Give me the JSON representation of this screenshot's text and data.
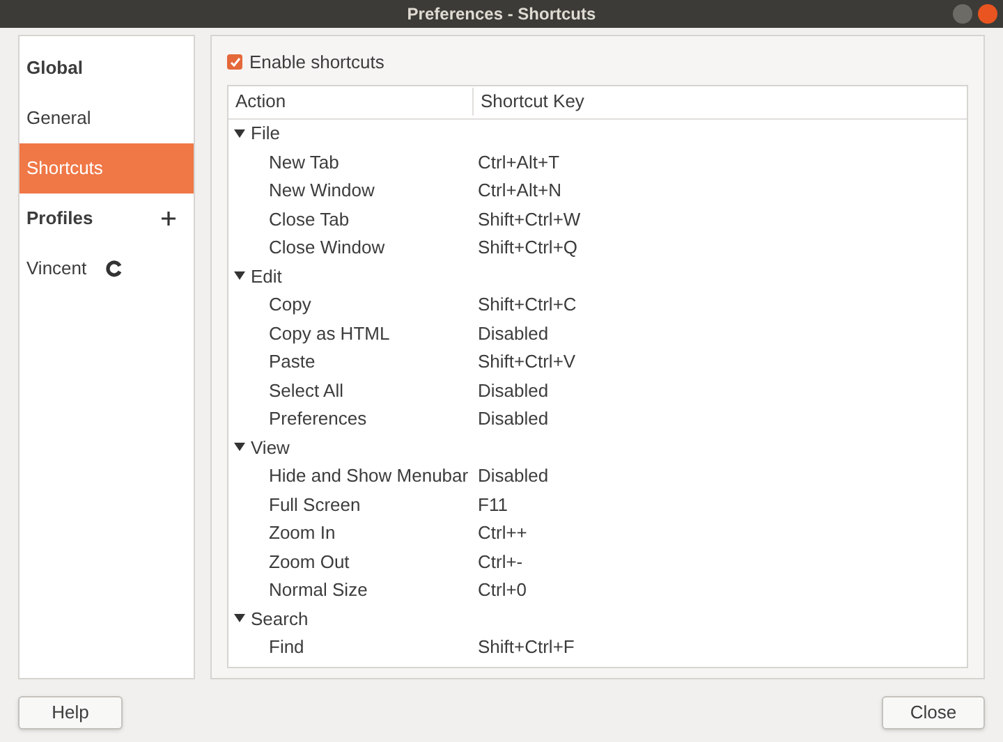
{
  "window": {
    "title": "Preferences - Shortcuts"
  },
  "sidebar": {
    "items": [
      {
        "kind": "header",
        "label": "Global"
      },
      {
        "kind": "item",
        "label": "General",
        "selected": false
      },
      {
        "kind": "item",
        "label": "Shortcuts",
        "selected": true
      },
      {
        "kind": "header",
        "label": "Profiles",
        "addable": true
      },
      {
        "kind": "item",
        "label": "Vincent",
        "selected": false,
        "default": true
      }
    ]
  },
  "enable_shortcuts": {
    "label": "Enable shortcuts",
    "checked": true
  },
  "table": {
    "columns": [
      "Action",
      "Shortcut Key"
    ],
    "groups": [
      {
        "label": "File",
        "expanded": true,
        "children": [
          {
            "action": "New Tab",
            "key": "Ctrl+Alt+T"
          },
          {
            "action": "New Window",
            "key": "Ctrl+Alt+N"
          },
          {
            "action": "Close Tab",
            "key": "Shift+Ctrl+W"
          },
          {
            "action": "Close Window",
            "key": "Shift+Ctrl+Q"
          }
        ]
      },
      {
        "label": "Edit",
        "expanded": true,
        "children": [
          {
            "action": "Copy",
            "key": "Shift+Ctrl+C"
          },
          {
            "action": "Copy as HTML",
            "key": "Disabled"
          },
          {
            "action": "Paste",
            "key": "Shift+Ctrl+V"
          },
          {
            "action": "Select All",
            "key": "Disabled"
          },
          {
            "action": "Preferences",
            "key": "Disabled"
          }
        ]
      },
      {
        "label": "View",
        "expanded": true,
        "children": [
          {
            "action": "Hide and Show Menubar",
            "key": "Disabled"
          },
          {
            "action": "Full Screen",
            "key": "F11"
          },
          {
            "action": "Zoom In",
            "key": "Ctrl++"
          },
          {
            "action": "Zoom Out",
            "key": "Ctrl+-"
          },
          {
            "action": "Normal Size",
            "key": "Ctrl+0"
          }
        ]
      },
      {
        "label": "Search",
        "expanded": true,
        "children": [
          {
            "action": "Find",
            "key": "Shift+Ctrl+F"
          }
        ]
      }
    ]
  },
  "buttons": {
    "help": "Help",
    "close": "Close"
  }
}
